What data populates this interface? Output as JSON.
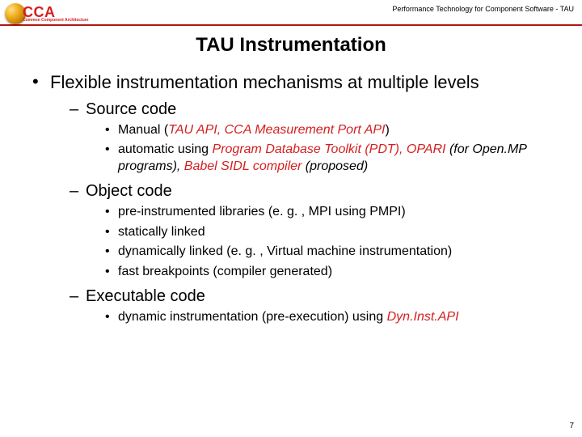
{
  "header": {
    "logo_text": "CCA",
    "logo_subtext": "Common Component Architecture",
    "right_text": "Performance Technology for Component Software - TAU"
  },
  "title": "TAU Instrumentation",
  "bullets": {
    "l1": "Flexible instrumentation mechanisms at multiple levels",
    "s1": "Source code",
    "s1a_pre": "Manual (",
    "s1a_i1": "TAU API, CCA Measurement Port API",
    "s1a_post": ")",
    "s1b_pre": "automatic using ",
    "s1b_i1": "Program Database Toolkit (PDT), OPARI",
    "s1b_mid": " (for Open.MP programs), ",
    "s1b_i2": "Babel SIDL compiler",
    "s1b_post": " (proposed)",
    "s2": "Object code",
    "s2a": "pre-instrumented libraries (e. g. , MPI using PMPI)",
    "s2b": "statically linked",
    "s2c": "dynamically linked (e. g. , Virtual machine instrumentation)",
    "s2d": "fast breakpoints (compiler generated)",
    "s3": "Executable code",
    "s3a_pre": "dynamic instrumentation (pre-execution) using ",
    "s3a_i1": "Dyn.Inst.API"
  },
  "page_number": "7"
}
